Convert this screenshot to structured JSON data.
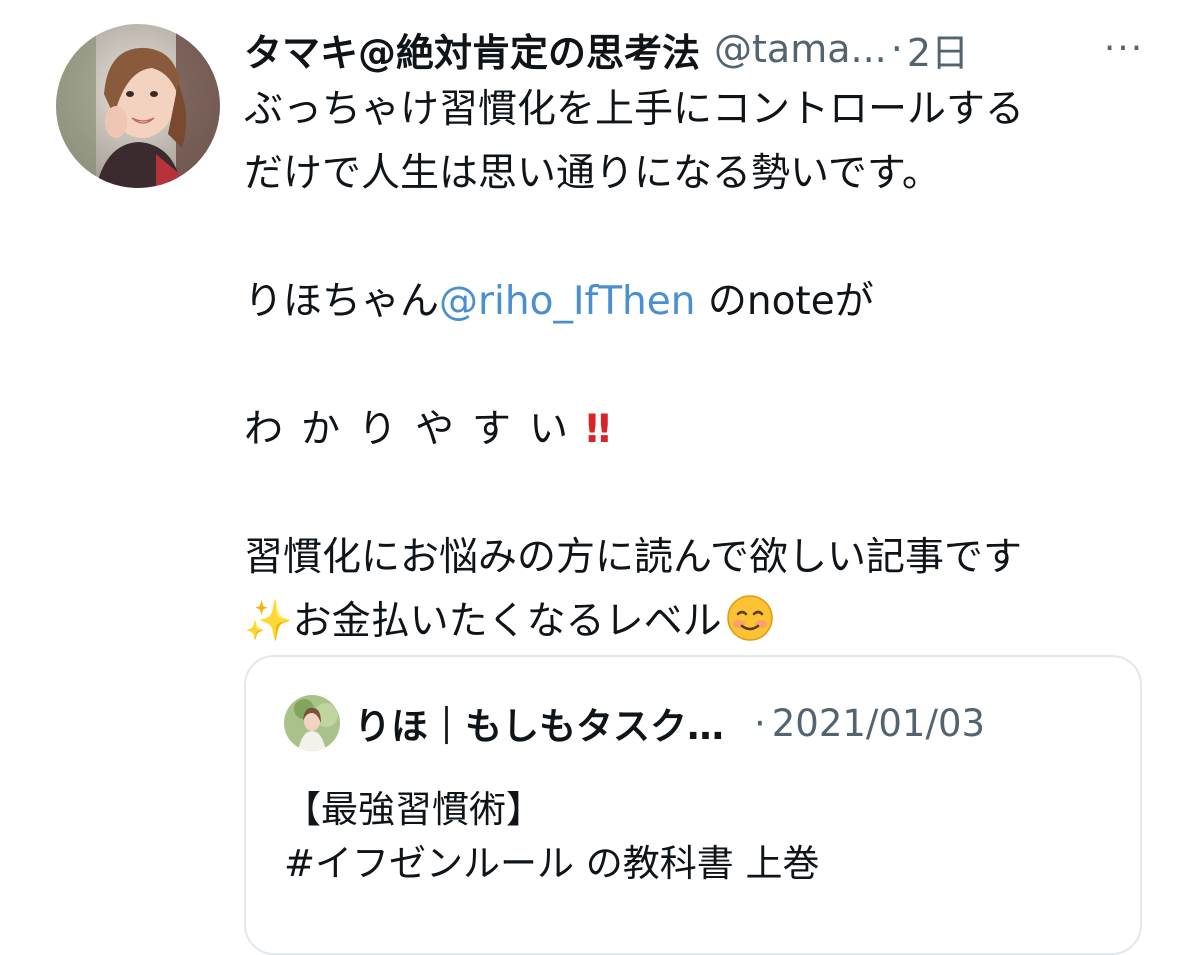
{
  "tweet": {
    "display_name": "タマキ@絶対肯定の思考法",
    "handle": "@tama...",
    "separator": "·",
    "time": "2日",
    "more_icon": "···",
    "lines": {
      "l1": "ぶっちゃけ習慣化を上手にコントロールする",
      "l2": "だけで人生は思い通りになる勢いです。",
      "l3_prefix": "りほちゃん",
      "l3_mention": "@riho_IfThen",
      "l3_suffix": " のnoteが",
      "l4": "わかりやすい",
      "l4_emoji": "‼",
      "l5": "習慣化にお悩みの方に読んで欲しい記事です",
      "l6_sparkle": "✨",
      "l6_text": "お金払いたくなるレベル"
    }
  },
  "quote": {
    "author": "りほ｜もしもタスク…",
    "separator": "·",
    "date": "2021/01/03",
    "line1": "【最強習慣術】",
    "line2": "#イフゼンルール の教科書 上巻"
  }
}
